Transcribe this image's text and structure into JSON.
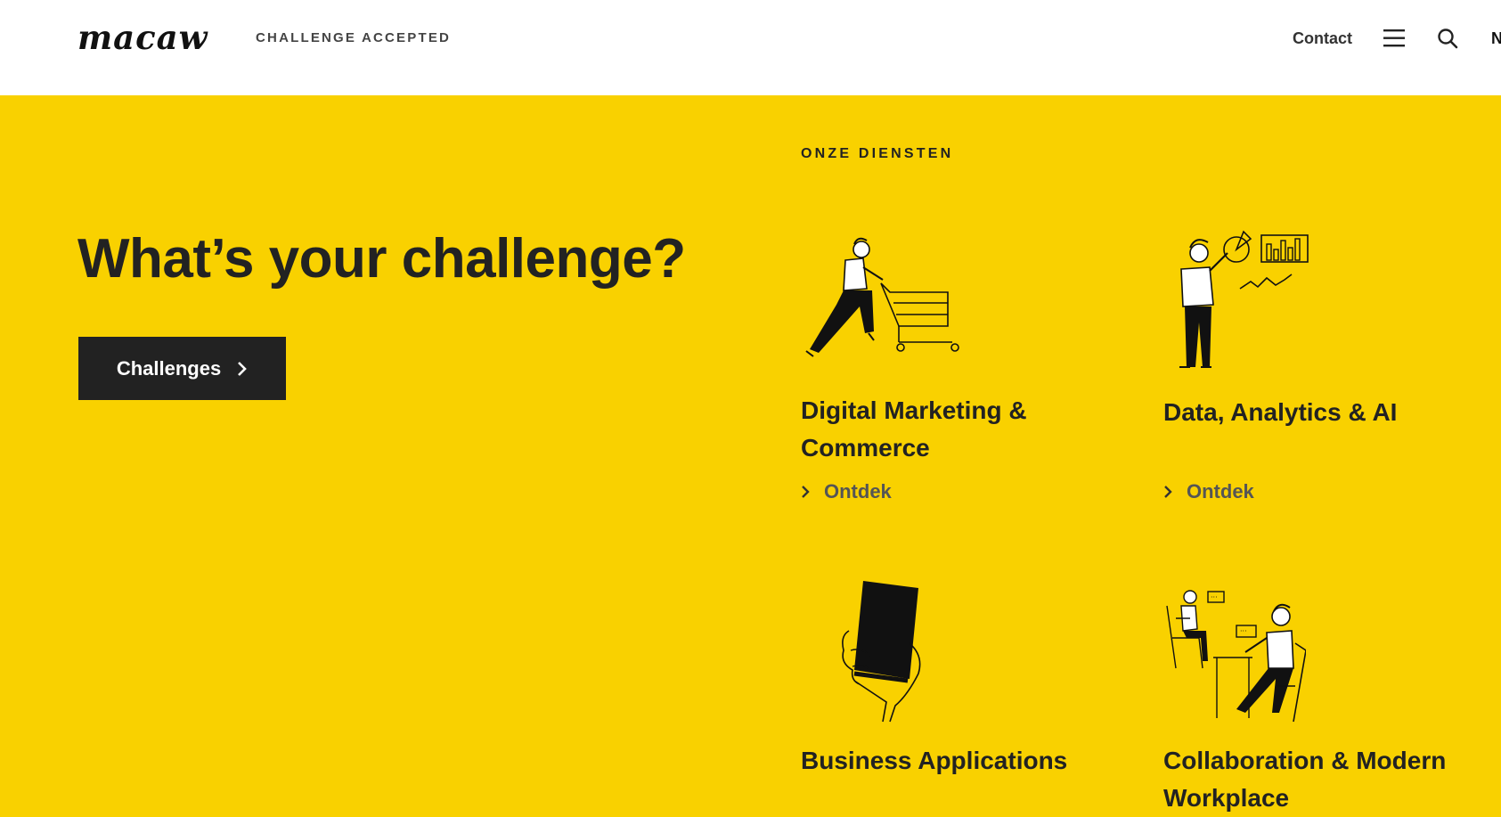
{
  "header": {
    "logo": "macaw",
    "tagline": "CHALLENGE ACCEPTED",
    "contact_label": "Contact",
    "language_label": "N",
    "menu_icon": "hamburger-menu-icon",
    "search_icon": "search-icon"
  },
  "hero": {
    "title": "What’s your challenge?",
    "cta_label": "Challenges"
  },
  "services": {
    "section_label": "ONZE DIENSTEN",
    "items": [
      {
        "title": "Digital Marketing & Commerce",
        "link_label": "Ontdek",
        "icon": "shopping-cart-person-icon"
      },
      {
        "title": "Data, Analytics & AI",
        "link_label": "Ontdek",
        "icon": "analytics-presenter-icon"
      },
      {
        "title": "Business Applications",
        "icon": "smartphone-hand-icon"
      },
      {
        "title": "Collaboration & Modern Workplace",
        "icon": "people-collaborating-icon"
      }
    ]
  },
  "colors": {
    "background": "#f9d100",
    "header_bg": "#ffffff",
    "text": "#222222",
    "button_bg": "#222222",
    "button_text": "#ffffff",
    "link_text": "#555555"
  }
}
